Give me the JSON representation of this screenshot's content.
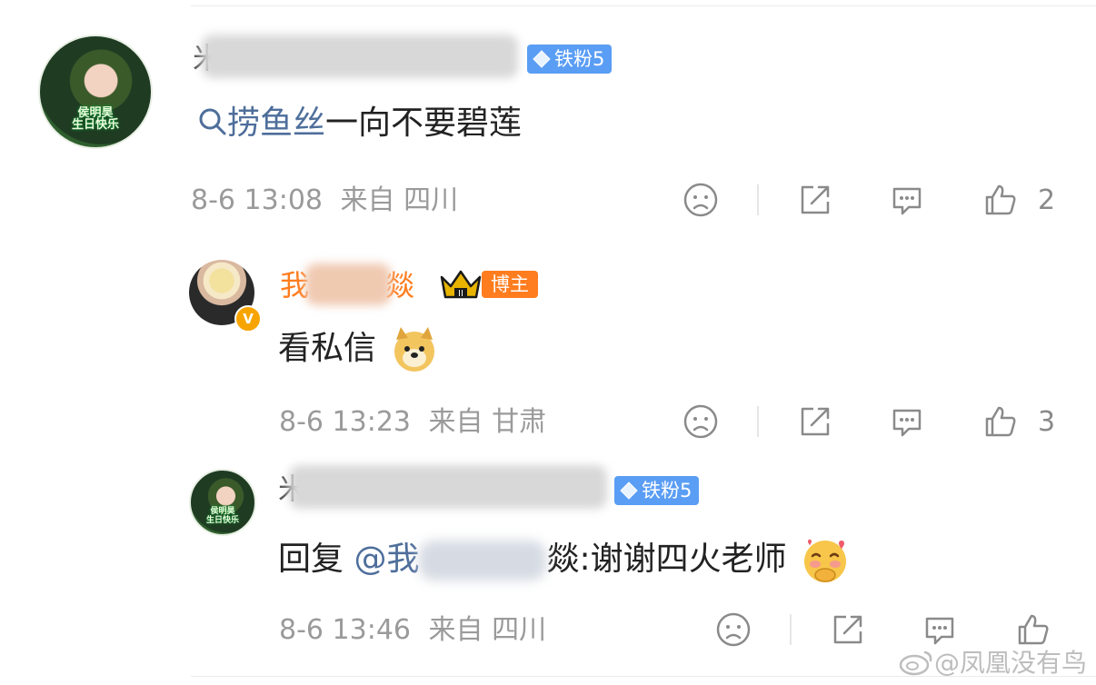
{
  "comment": {
    "name_visible_prefix": "米",
    "badge": "铁粉5",
    "text_search": "捞鱼丝",
    "text_rest": "一向不要碧莲",
    "avatar_caption_line1": "侯明昊",
    "avatar_caption_line2": "生日快乐",
    "timestamp": "8-6 13:08",
    "location": "来自 四川",
    "likes": "2"
  },
  "reply1": {
    "name_first": "我",
    "name_last": "燚",
    "host_badge": "博主",
    "verified": "V",
    "text": "看私信",
    "timestamp": "8-6 13:23",
    "location": "来自 甘肃",
    "likes": "3"
  },
  "reply2": {
    "name_visible_prefix": "米",
    "badge": "铁粉5",
    "reply_prefix": "回复",
    "mention_start": "@我",
    "mention_end": "燚",
    "text": ":谢谢四火老师",
    "avatar_caption_line1": "侯明昊",
    "avatar_caption_line2": "生日快乐",
    "timestamp": "8-6 13:46",
    "location": "来自 四川"
  },
  "watermark": "@凤凰没有鸟",
  "icons": [
    "dislike-icon",
    "share-icon",
    "comment-icon",
    "like-icon",
    "search-icon",
    "crown-icon",
    "diamond-icon",
    "doge-emoji",
    "shy-emoji",
    "weibo-logo-icon"
  ],
  "colors": {
    "link": "#4e6e9b",
    "fan_badge": "#5a9df4",
    "host_badge": "#ff7d1f",
    "verified": "#f7a400",
    "meta": "#9a9a9a"
  }
}
